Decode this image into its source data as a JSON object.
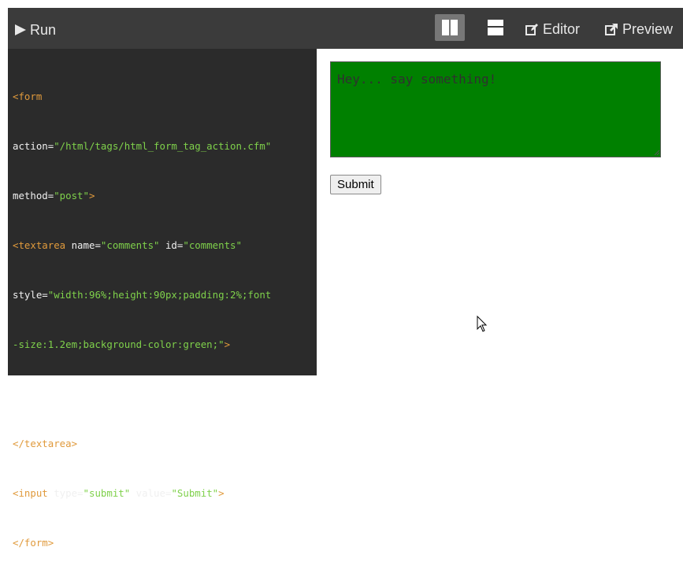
{
  "toolbar": {
    "run_label": "Run",
    "run_icon": "play-icon",
    "layout_side_icon": "columns-icon",
    "layout_stack_icon": "rows-icon",
    "editor_label": "Editor",
    "editor_icon": "edit-icon",
    "preview_label": "Preview",
    "preview_icon": "external-link-icon"
  },
  "code": {
    "l1_tag": "<form",
    "l2_attr": "action=",
    "l2_val": "\"/html/tags/html_form_tag_action.cfm\"",
    "l3_attr": "method=",
    "l3_val": "\"post\"",
    "l3_close": ">",
    "l4_tag": "<textarea",
    "l4_attr1": " name=",
    "l4_val1": "\"comments\"",
    "l4_attr2": " id=",
    "l4_val2": "\"comments\"",
    "l5_attr": "style=",
    "l5_val": "\"width:96%;height:90px;padding:2%;font",
    "l6_val": "-size:1.2em;background-color:green;\"",
    "l6_close": ">",
    "l7_text": "Hey... say something!",
    "l8_tag": "</textarea>",
    "l9_tag": "<input",
    "l9_attr1": " type=",
    "l9_val1": "\"submit\"",
    "l9_attr2": " value=",
    "l9_val2": "\"Submit\"",
    "l9_close": ">",
    "l10_tag": "</form>"
  },
  "preview": {
    "textarea_value": "Hey... say something!",
    "textarea_bg": "#008000",
    "submit_label": "Submit"
  },
  "colors": {
    "toolbar_bg": "#3b3b3b",
    "editor_bg": "#2b2b2b",
    "tag": "#e09a3c",
    "string": "#7fd14b"
  }
}
